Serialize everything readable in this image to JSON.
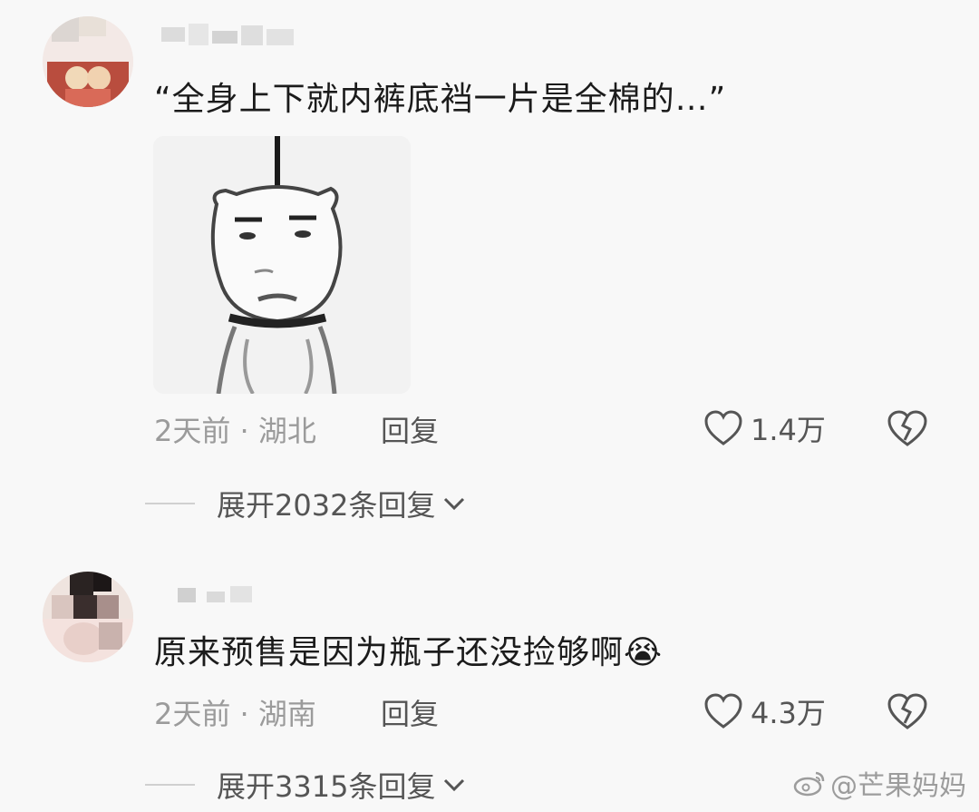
{
  "comments": [
    {
      "text": "“全身上下就内裤底裆一片是全棉的…”",
      "meta": "2天前 · 湖北",
      "reply_label": "回复",
      "likes": "1.4万",
      "expand_label": "展开2032条回复"
    },
    {
      "text": "原来预售是因为瓶子还没捡够啊😭",
      "meta": "2天前 · 湖南",
      "reply_label": "回复",
      "likes": "4.3万",
      "expand_label": "展开3315条回复"
    }
  ],
  "watermark": "@芒果妈妈",
  "icons": {
    "like": "heart-outline-icon",
    "dislike": "broken-heart-icon",
    "expand": "chevron-down-icon",
    "watermark": "weibo-logo-icon"
  }
}
